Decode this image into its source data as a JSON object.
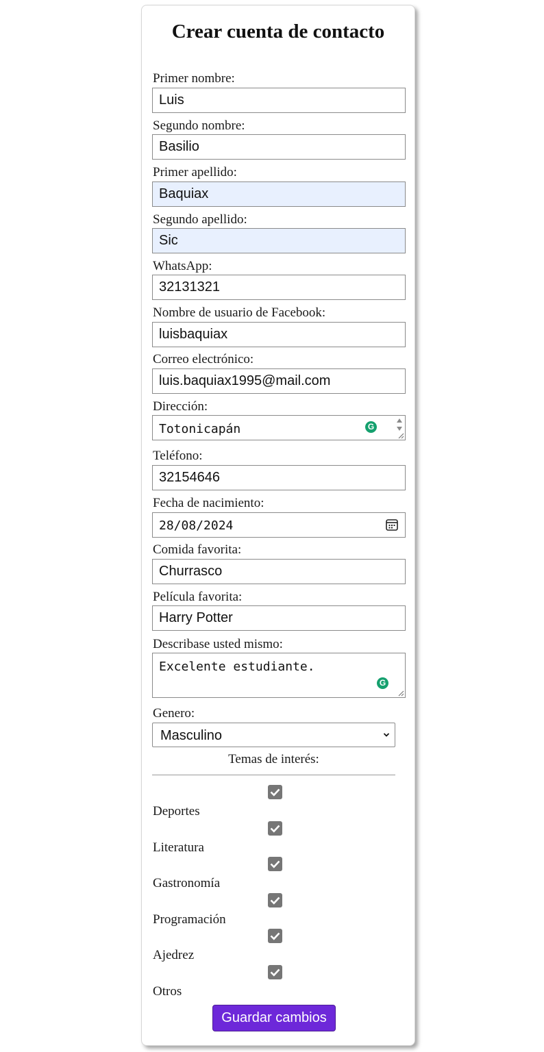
{
  "form": {
    "title": "Crear cuenta de contacto",
    "fields": {
      "first_name": {
        "label": "Primer nombre:",
        "value": "Luis"
      },
      "second_name": {
        "label": "Segundo nombre:",
        "value": "Basilio"
      },
      "first_surname": {
        "label": "Primer apellido:",
        "value": "Baquiax"
      },
      "second_surname": {
        "label": "Segundo apellido:",
        "value": "Sic"
      },
      "whatsapp": {
        "label": "WhatsApp:",
        "value": "32131321"
      },
      "facebook": {
        "label": "Nombre de usuario de Facebook:",
        "value": "luisbaquiax"
      },
      "email": {
        "label": "Correo electrónico:",
        "value": "luis.baquiax1995@mail.com"
      },
      "address": {
        "label": "Dirección:",
        "value": "Totonicapán"
      },
      "phone": {
        "label": "Teléfono:",
        "value": "32154646"
      },
      "birthdate": {
        "label": "Fecha de nacimiento:",
        "value": "28/08/2024"
      },
      "favorite_food": {
        "label": "Comida favorita:",
        "value": "Churrasco"
      },
      "favorite_movie": {
        "label": "Película favorita:",
        "value": "Harry Potter"
      },
      "description": {
        "label": "Describase usted mismo:",
        "value": "Excelente estudiante."
      }
    },
    "gender": {
      "label": "Genero:",
      "selected": "Masculino"
    },
    "interests": {
      "title": "Temas de interés:",
      "items": [
        {
          "label": "Deportes",
          "checked": true
        },
        {
          "label": "Literatura",
          "checked": true
        },
        {
          "label": "Gastronomía",
          "checked": true
        },
        {
          "label": "Programación",
          "checked": true
        },
        {
          "label": "Ajedrez",
          "checked": true
        },
        {
          "label": "Otros",
          "checked": true
        }
      ]
    },
    "save_button": "Guardar cambios"
  },
  "colors": {
    "autofill_bg": "#e8f0fe",
    "button_bg": "#6d28d9",
    "checkbox_bg": "#767676",
    "grammarly_green": "#15a06e"
  },
  "icons": {
    "grammarly": "grammarly-icon",
    "calendar": "calendar-icon",
    "dropdown": "chevron-down-icon",
    "check": "checkmark-icon"
  }
}
